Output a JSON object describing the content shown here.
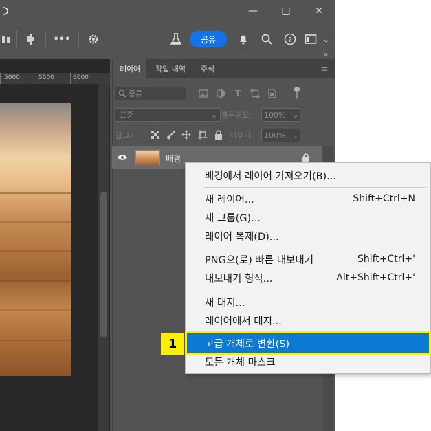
{
  "titlebar": {
    "minimize": "—",
    "maximize": "□",
    "close": "✕"
  },
  "optionsbar": {
    "more": "•••",
    "share_label": "공유",
    "dropdown": "⌄"
  },
  "ruler": {
    "labels": [
      "5000",
      "5500",
      "6000"
    ]
  },
  "panel": {
    "tabs": [
      {
        "label": "레이어"
      },
      {
        "label": "작업 내역"
      },
      {
        "label": "주석"
      }
    ],
    "collapse": "»",
    "menu_icon": "≡",
    "filter": {
      "kind_label": "종류"
    },
    "blend_mode": "표준",
    "opacity_label": "불투명도:",
    "opacity_value": "100%",
    "lock_label": "잠그기:",
    "fill_label": "채우기:",
    "fill_value": "100%",
    "layer": {
      "name": "배경"
    }
  },
  "context_menu": {
    "items": [
      {
        "label": "배경에서 레이어 가져오기(B)...",
        "shortcut": ""
      },
      {
        "label": "새 레이어...",
        "shortcut": "Shift+Ctrl+N"
      },
      {
        "label": "새 그룹(G)...",
        "shortcut": ""
      },
      {
        "label": "레이어 복제(D)...",
        "shortcut": ""
      },
      {
        "label": "PNG으(로) 빠른 내보내기",
        "shortcut": "Shift+Ctrl+'"
      },
      {
        "label": "내보내기 형식...",
        "shortcut": "Alt+Shift+Ctrl+'"
      },
      {
        "label": "새 대지...",
        "shortcut": ""
      },
      {
        "label": "레이어에서 대지...",
        "shortcut": ""
      },
      {
        "label": "고급 개체로 변환(S)",
        "shortcut": ""
      },
      {
        "label": "모든 개체 마스크",
        "shortcut": ""
      }
    ]
  },
  "annotation": {
    "step": "1"
  },
  "colors": {
    "accent": "#1473e6",
    "highlight": "#0a7ad6",
    "callout": "#ffee00"
  }
}
